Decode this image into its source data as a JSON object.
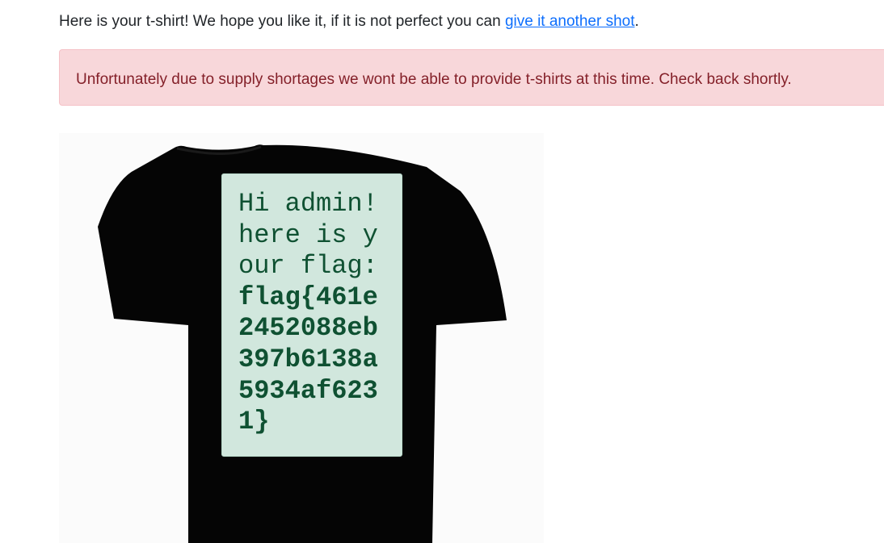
{
  "intro": {
    "text": "Here is your t-shirt! We hope you like it, if it is not perfect you can ",
    "link_text": "give it another shot",
    "suffix": "."
  },
  "alert": {
    "message": "Unfortunately due to supply shortages we wont be able to provide t-shirts at this time. Check back shortly."
  },
  "shirt": {
    "greeting_lines": [
      "Hi admin!",
      "here is y",
      "our flag:"
    ],
    "flag_lines": [
      "flag{461e",
      "2452088eb",
      "397b6138a",
      "5934af623",
      "1}"
    ],
    "shirt_color": "#050505",
    "panel_color": "#d1e7dd",
    "text_color": "#0f5132"
  }
}
